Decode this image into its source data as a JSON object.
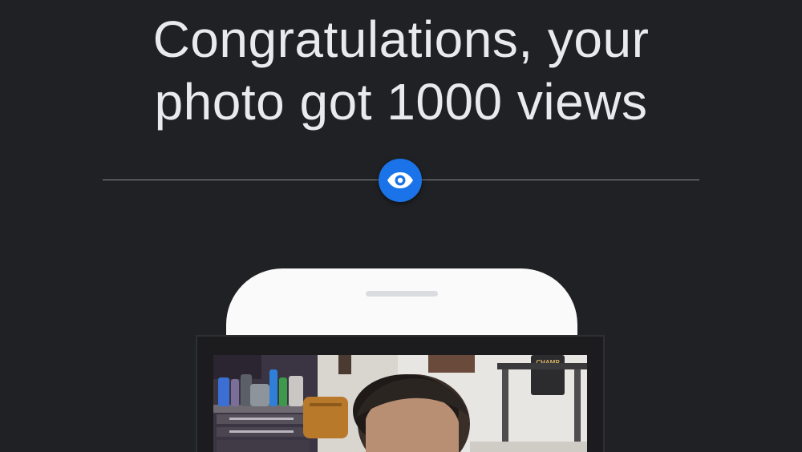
{
  "headline": {
    "line1": "Congratulations, your",
    "line2": "photo got 1000 views"
  },
  "badge": {
    "icon": "eye-icon",
    "color": "#1a73e8"
  },
  "photo": {
    "sign_text": "CHAMP"
  },
  "colors": {
    "background": "#202124",
    "text": "#e8eaed",
    "accent": "#1a73e8",
    "phone": "#fafafa"
  }
}
